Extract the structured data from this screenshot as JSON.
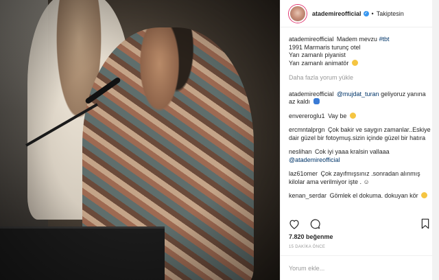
{
  "post": {
    "username": "atademireofficial",
    "follow_status": "Takiptesin",
    "dot": "•",
    "verified_glyph": "✓"
  },
  "caption": {
    "username": "atademireofficial",
    "text_intro": "Madem mevzu",
    "hashtag": "#tbt",
    "line2": "1991 Marmaris turunç otel",
    "line3": "Yarı zamanlı piyanist",
    "line4": "Yarı zamanlı animatör"
  },
  "load_more_label": "Daha fazla yorum yükle",
  "comments": [
    {
      "user": "atademireofficial",
      "mention": "@mujdat_turan",
      "text": "geliyoruz yanına az kaldı"
    },
    {
      "user": "envereroglu1",
      "text": "Vay be"
    },
    {
      "user": "ercmntalprgn",
      "text": "Çok bakir ve saygın zamanlar..Eskiye dair güzel bir fotoymuş.sizin içinde güzel bir hatıra"
    },
    {
      "user": "neslihan",
      "text": "Cok iyi yaaa kralsin vallaaa",
      "mention": "@atademireofficial"
    },
    {
      "user": "laz61omer",
      "text": "Çok zayıfmışsınız .sonradan alınmış kilolar ama verilmiyor işte . ☺"
    },
    {
      "user": "kenan_serdar",
      "text": "Gömlek el dokuma. dokuyan kör"
    }
  ],
  "likes": "7.820 beğenme",
  "timestamp": "15 DAKİKA ÖNCE",
  "add_comment_placeholder": "Yorum ekle...",
  "colors": {
    "link": "#003569",
    "verified": "#3897f0",
    "muted": "#999999"
  },
  "icons": [
    "heart-icon",
    "comment-icon",
    "bookmark-icon",
    "verified-icon"
  ]
}
